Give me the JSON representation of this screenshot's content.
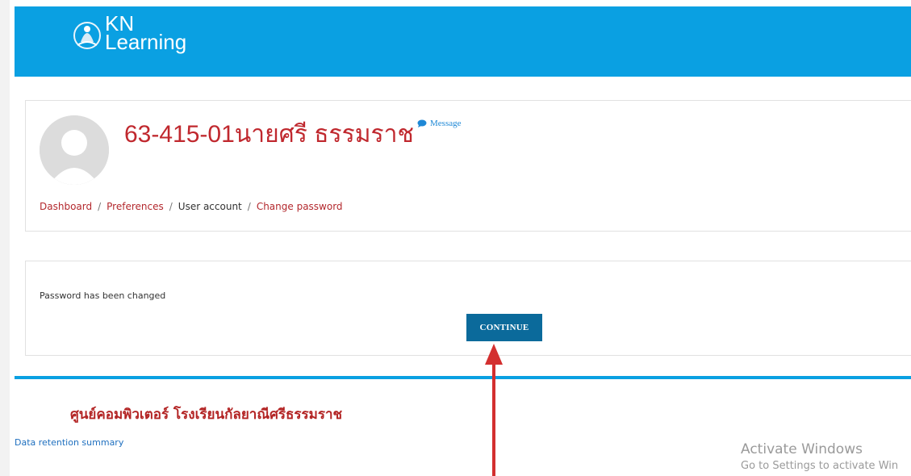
{
  "logo": {
    "line1": "KN",
    "line2": "Learning"
  },
  "profile": {
    "name": "63-415-01นายศรี ธรรมราช",
    "message_label": "Message"
  },
  "breadcrumb": [
    {
      "label": "Dashboard"
    },
    {
      "label": "Preferences"
    },
    {
      "label": "User account"
    },
    {
      "label": "Change password"
    }
  ],
  "notice": {
    "text": "Password has been changed",
    "continue_label": "CONTINUE"
  },
  "footer": {
    "title": "ศูนย์คอมพิวเตอร์  โรงเรียนกัลยาณีศรีธรรมราช",
    "data_retention_link": "Data retention summary"
  },
  "watermark": {
    "line1": "Activate Windows",
    "line2": "Go to Settings to activate Win"
  },
  "colors": {
    "brand_blue": "#0aa0e2",
    "title_red": "#c0282e",
    "button_blue": "#0b6a9b",
    "arrow_red": "#d32f2f"
  },
  "icons": [
    "logo-emblem-icon",
    "message-bubble-icon",
    "default-avatar-icon",
    "annotation-arrow-icon"
  ]
}
